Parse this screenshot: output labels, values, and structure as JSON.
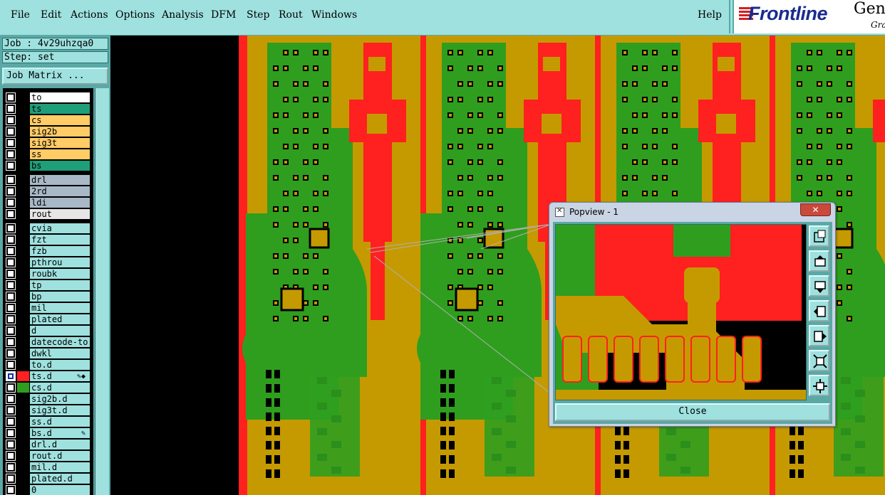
{
  "menubar": {
    "menus": [
      "File",
      "Edit",
      "Actions",
      "Options",
      "Analysis",
      "DFM",
      "Step",
      "Rout",
      "Windows"
    ],
    "help": "Help"
  },
  "logo": {
    "brand": "Frontline",
    "product": "Gen",
    "tagline": "Gra"
  },
  "job_panel": {
    "job": "Job : 4v29uhzqa0",
    "step": "Step: set",
    "matrix_button": "Job Matrix ..."
  },
  "layers": [
    {
      "name": "to",
      "color": "#ffffff",
      "checked": false
    },
    {
      "name": "ts",
      "color": "#1f9e7a",
      "checked": false
    },
    {
      "name": "cs",
      "color": "#ffcc66",
      "checked": false
    },
    {
      "name": "sig2b",
      "color": "#ffcc66",
      "checked": false
    },
    {
      "name": "sig3t",
      "color": "#ffcc66",
      "checked": false
    },
    {
      "name": "ss",
      "color": "#ffcc66",
      "checked": false
    },
    {
      "name": "bs",
      "color": "#1f9e7a",
      "checked": false
    },
    {
      "name": "drl",
      "color": "#a9b8c6",
      "checked": false
    },
    {
      "name": "2rd",
      "color": "#a9b8c6",
      "checked": false
    },
    {
      "name": "ldi",
      "color": "#a9b8c6",
      "checked": false
    },
    {
      "name": "rout",
      "color": "#e6e6e6",
      "checked": false
    },
    {
      "name": "cvia",
      "color": "#9ee1df",
      "checked": false
    },
    {
      "name": "fzt",
      "color": "#9ee1df",
      "checked": false
    },
    {
      "name": "fzb",
      "color": "#9ee1df",
      "checked": false
    },
    {
      "name": "pthrou",
      "color": "#9ee1df",
      "checked": false
    },
    {
      "name": "roubk",
      "color": "#9ee1df",
      "checked": false
    },
    {
      "name": "tp",
      "color": "#9ee1df",
      "checked": false
    },
    {
      "name": "bp",
      "color": "#9ee1df",
      "checked": false
    },
    {
      "name": "mil",
      "color": "#9ee1df",
      "checked": false
    },
    {
      "name": "plated",
      "color": "#9ee1df",
      "checked": false
    },
    {
      "name": "d",
      "color": "#9ee1df",
      "checked": false
    },
    {
      "name": "datecode-to",
      "color": "#9ee1df",
      "checked": false
    },
    {
      "name": "dwkl",
      "color": "#9ee1df",
      "checked": false
    },
    {
      "name": "to.d",
      "color": "#9ee1df",
      "checked": false
    },
    {
      "name": "ts.d",
      "color": "#9ee1df",
      "checked": true,
      "swatch": "#ff2020",
      "mark": "✎◆"
    },
    {
      "name": "cs.d",
      "color": "#9ee1df",
      "checked": false,
      "swatch": "#2f9e1e"
    },
    {
      "name": "sig2b.d",
      "color": "#9ee1df",
      "checked": false
    },
    {
      "name": "sig3t.d",
      "color": "#9ee1df",
      "checked": false
    },
    {
      "name": "ss.d",
      "color": "#9ee1df",
      "checked": false
    },
    {
      "name": "bs.d",
      "color": "#9ee1df",
      "checked": false,
      "mark": "✎"
    },
    {
      "name": "drl.d",
      "color": "#9ee1df",
      "checked": false
    },
    {
      "name": "rout.d",
      "color": "#9ee1df",
      "checked": false
    },
    {
      "name": "mil.d",
      "color": "#9ee1df",
      "checked": false
    },
    {
      "name": "plated.d",
      "color": "#9ee1df",
      "checked": false
    },
    {
      "name": "0",
      "color": "#9ee1df",
      "checked": false
    }
  ],
  "canvas": {
    "colors": {
      "background": "#000000",
      "copper_top": "#ff2020",
      "copper_bottom": "#2f9e1e",
      "overlap": "#c59a00",
      "board": "#000000"
    }
  },
  "popview": {
    "title": "Popview - 1",
    "close_label": "Close",
    "tools": [
      "zoom-fit-icon",
      "pan-up-icon",
      "pan-down-icon",
      "pan-left-icon",
      "pan-right-icon",
      "zoom-in-icon",
      "zoom-out-icon"
    ]
  }
}
